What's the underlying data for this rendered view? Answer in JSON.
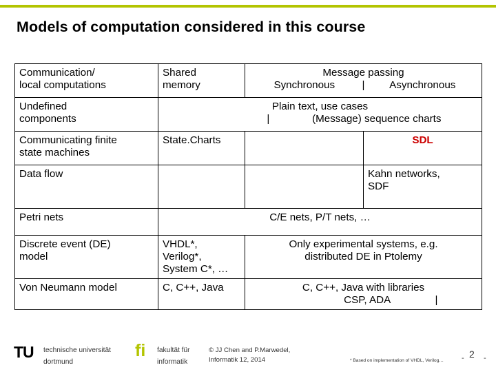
{
  "slide": {
    "title": "Models of computation considered in this course",
    "page_number": "2"
  },
  "table": {
    "header": {
      "col_a_line1": "Communication/",
      "col_a_line2": "local computations",
      "col_b_line1": "Shared",
      "col_b_line2": "memory",
      "msg_passing": "Message passing",
      "synchronous": "Synchronous",
      "asynchronous": "Asynchronous",
      "separator": "|"
    },
    "rows": [
      {
        "label_line1": "Undefined",
        "label_line2": "components",
        "merged_line1": "Plain text, use cases",
        "merged_line2_left": "|",
        "merged_line2_right": "(Message) sequence charts"
      },
      {
        "label_line1": "Communicating finite",
        "label_line2": "state machines",
        "shared_memory": "State.Charts",
        "synchronous": "",
        "asynchronous": "SDL"
      },
      {
        "label_line1": "Data flow",
        "label_line2": "",
        "shared_memory": "",
        "synchronous": "",
        "asynchronous_line1": "Kahn networks,",
        "asynchronous_line2": "SDF"
      },
      {
        "label": "Petri nets",
        "merged": "C/E nets, P/T nets, …"
      },
      {
        "label_line1": "Discrete event (DE)",
        "label_line2": "model",
        "shared_memory_line1": "VHDL*,",
        "shared_memory_line2": "Verilog*,",
        "shared_memory_line3": "System C*, …",
        "merged_line1": "Only experimental systems, e.g.",
        "merged_line2": "distributed DE in Ptolemy"
      },
      {
        "label": "Von Neumann model",
        "shared_memory": "C, C++, Java",
        "merged_line1": "C, C++, Java with libraries",
        "merged_line2": "CSP, ADA",
        "separator": "|"
      }
    ]
  },
  "footer": {
    "tu_logo": "TU",
    "tu_line1": "technische universität",
    "tu_line2": "dortmund",
    "fi_logo": "fi",
    "fak_line1": "fakultät für",
    "fak_line2": "informatik",
    "copyright_line1": "© JJ Chen and  P.Marwedel,",
    "copyright_line2": "Informatik 12, 2014",
    "based_note": "* Based on implementation of VHDL, Verilog…",
    "page_dash_left": "-",
    "page_dash_right": "-"
  }
}
